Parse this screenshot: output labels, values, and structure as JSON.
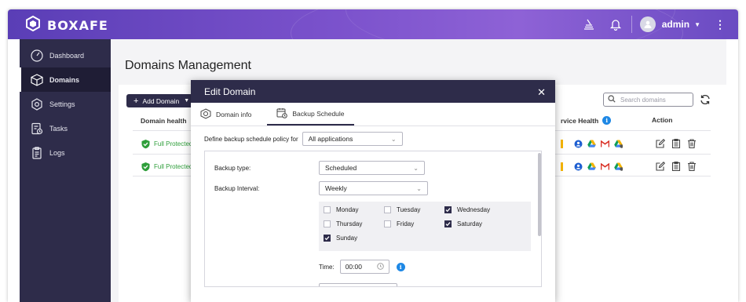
{
  "app": {
    "brand": "BOXAFE",
    "user": "admin"
  },
  "header_icons": [
    "stack-icon",
    "bell-icon",
    "avatar",
    "kebab-icon"
  ],
  "sidebar": {
    "items": [
      {
        "label": "Dashboard",
        "icon": "dashboard-icon",
        "active": false
      },
      {
        "label": "Domains",
        "icon": "domains-icon",
        "active": true
      },
      {
        "label": "Settings",
        "icon": "gear-icon",
        "active": false
      },
      {
        "label": "Tasks",
        "icon": "tasks-icon",
        "active": false
      },
      {
        "label": "Logs",
        "icon": "logs-icon",
        "active": false
      }
    ]
  },
  "main": {
    "title": "Domains Management",
    "add_button": "Add Domain",
    "search_placeholder": "Search domains",
    "columns": {
      "domain_health": "Domain health",
      "service_health": "rvice Health",
      "action": "Action"
    },
    "rows": [
      {
        "status": "Full Protected"
      },
      {
        "status": "Full Protected"
      }
    ]
  },
  "modal": {
    "title": "Edit Domain",
    "tabs": [
      "Domain info",
      "Backup Schedule"
    ],
    "active_tab": "Backup Schedule",
    "policy_label": "Define backup schedule policy for",
    "policy_value": "All applications",
    "backup_type_label": "Backup type:",
    "backup_type_value": "Scheduled",
    "interval_label": "Backup Interval:",
    "interval_value": "Weekly",
    "days": [
      {
        "label": "Monday",
        "checked": false
      },
      {
        "label": "Tuesday",
        "checked": false
      },
      {
        "label": "Wednesday",
        "checked": true
      },
      {
        "label": "Thursday",
        "checked": false
      },
      {
        "label": "Friday",
        "checked": false
      },
      {
        "label": "Saturday",
        "checked": true
      },
      {
        "label": "Sunday",
        "checked": true
      }
    ],
    "time_label": "Time:",
    "time_value": "00:00"
  },
  "colors": {
    "brand": "#5a3eb6",
    "navy": "#2e2c4a",
    "ok": "#2e9e3a",
    "info": "#1e88e5"
  }
}
